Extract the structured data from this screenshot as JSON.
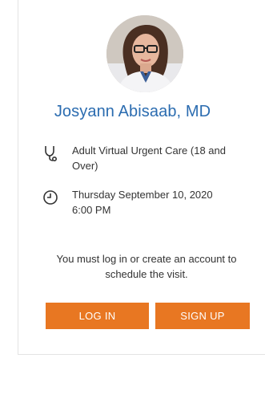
{
  "doctor": {
    "name": "Josyann Abisaab, MD"
  },
  "visit": {
    "type_line1": "Adult Virtual Urgent Care (18 and",
    "type_line2": "Over)",
    "date": "Thursday September 10, 2020",
    "time": "6:00 PM"
  },
  "notice": {
    "line1": "You must log in or create an account to",
    "line2": "schedule the visit."
  },
  "actions": {
    "login_label": "LOG IN",
    "signup_label": "SIGN UP"
  },
  "colors": {
    "accent": "#e87722",
    "name_blue": "#2b6cb0"
  },
  "icons": {
    "visit": "stethoscope-icon",
    "time": "clock-icon"
  }
}
